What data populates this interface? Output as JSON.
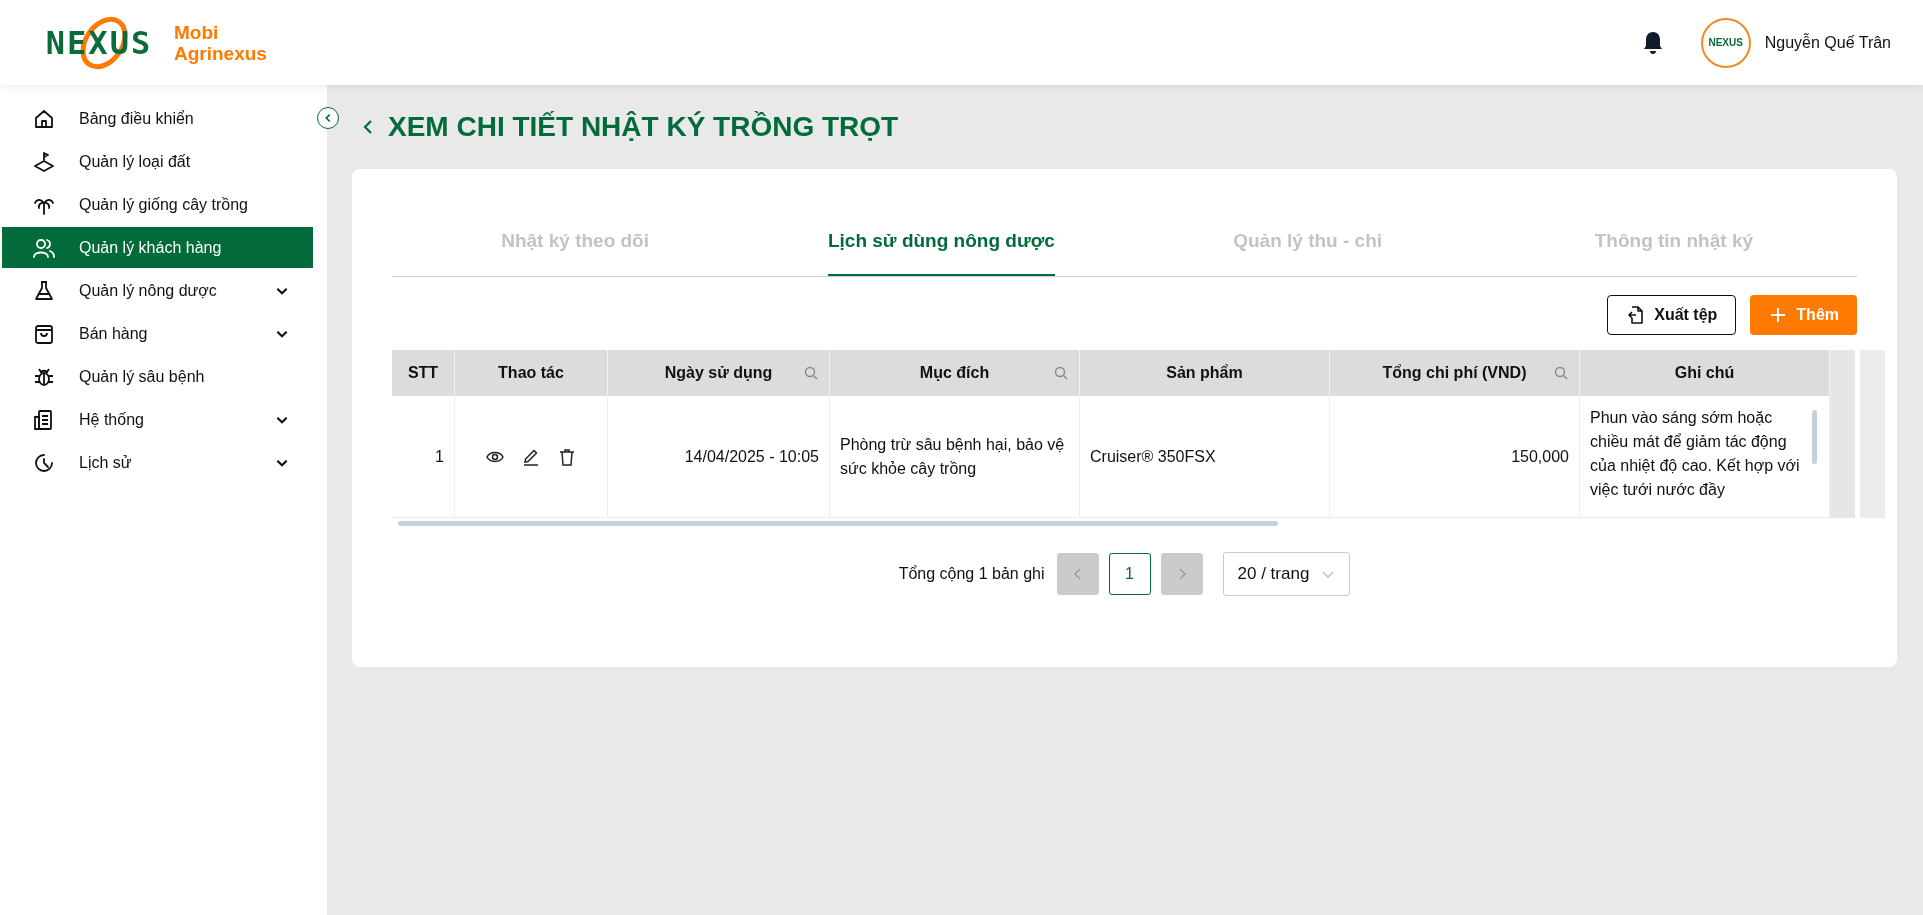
{
  "header": {
    "logo_text": "NEXUS",
    "brand_line_1": "Mobi",
    "brand_line_2": "Agrinexus",
    "avatar_text": "NEXUS",
    "user_name": "Nguyễn Quế Trân"
  },
  "sidebar": {
    "items": [
      {
        "label": "Bảng điều khiển",
        "selected": false,
        "has_submenu": false
      },
      {
        "label": "Quản lý loại đất",
        "selected": false,
        "has_submenu": false
      },
      {
        "label": "Quản lý giống cây trồng",
        "selected": false,
        "has_submenu": false
      },
      {
        "label": "Quản lý khách hàng",
        "selected": true,
        "has_submenu": false
      },
      {
        "label": "Quản lý nông dược",
        "selected": false,
        "has_submenu": true
      },
      {
        "label": "Bán hàng",
        "selected": false,
        "has_submenu": true
      },
      {
        "label": "Quản lý sâu bệnh",
        "selected": false,
        "has_submenu": false
      },
      {
        "label": "Hệ thống",
        "selected": false,
        "has_submenu": true
      },
      {
        "label": "Lịch sử",
        "selected": false,
        "has_submenu": true
      }
    ]
  },
  "page_title": "XEM CHI TIẾT NHẬT KÝ TRỒNG TRỌT",
  "tabs": [
    {
      "label": "Nhật ký theo dõi",
      "selected": false
    },
    {
      "label": "Lịch sử dùng nông dược",
      "selected": true
    },
    {
      "label": "Quản lý thu - chi",
      "selected": false
    },
    {
      "label": "Thông tin nhật ký",
      "selected": false
    }
  ],
  "toolbar": {
    "export_button": "Xuất tệp",
    "add_button": "Thêm"
  },
  "table": {
    "columns": [
      {
        "label": "STT",
        "searchable": false
      },
      {
        "label": "Thao tác",
        "searchable": false
      },
      {
        "label": "Ngày sử dụng",
        "searchable": true
      },
      {
        "label": "Mục đích",
        "searchable": true
      },
      {
        "label": "Sản phẩm",
        "searchable": false
      },
      {
        "label": "Tổng chi phí (VND)",
        "searchable": true
      },
      {
        "label": "Ghi chú",
        "searchable": false
      }
    ],
    "rows": [
      {
        "stt": "1",
        "date": "14/04/2025 - 10:05",
        "purpose": "Phòng trừ sâu bệnh hại, bảo vệ sức khỏe cây trồng",
        "product": "Cruiser® 350FSX",
        "cost": "150,000",
        "note": "Phun vào sáng sớm hoặc chiều mát để giảm tác động của nhiệt độ cao. Kết hợp với việc tưới nước đầy"
      }
    ]
  },
  "pagination": {
    "total": "Tổng cộng 1 bản ghi",
    "pages": [
      {
        "label": "1",
        "selected": true
      }
    ],
    "prev_disabled": true,
    "next_disabled": true,
    "page_size": "20 / trang"
  }
}
